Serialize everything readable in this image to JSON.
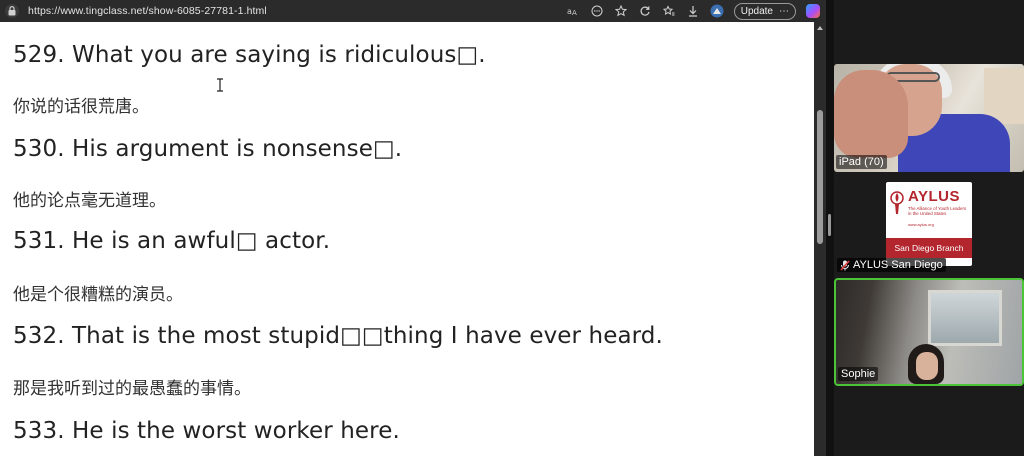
{
  "browser": {
    "url": "https://www.tingclass.net/show-6085-27781-1.html",
    "update_label": "Update",
    "more_label": "⋯"
  },
  "content": {
    "lines": [
      {
        "en": "529. What you are saying is ridiculous□.",
        "zh": "你说的话很荒唐。"
      },
      {
        "en": "530. His argument is nonsense□.",
        "zh": "他的论点毫无道理。"
      },
      {
        "en": "531. He is an awful□ actor.",
        "zh": "他是个很糟糕的演员。"
      },
      {
        "en": "532. That is the most stupid□□thing I have ever heard.",
        "zh": "那是我听到过的最愚蠢的事情。"
      },
      {
        "en": "533. He is the worst worker here."
      }
    ]
  },
  "video_panel": {
    "participants": [
      {
        "label": "iPad (70)"
      },
      {
        "label": "AYLUS San Diego",
        "muted": true,
        "card": {
          "title": "AYLUS",
          "subtitle": "The Alliance of Youth Leaders in the United States",
          "website": "www.aylus.org",
          "branch": "San Diego Branch"
        }
      },
      {
        "label": "Sophie",
        "active_speaker": true
      }
    ]
  },
  "colors": {
    "toolbar_bg": "#2b2b2b",
    "page_bg": "#ffffff",
    "aylus_red": "#b3262d",
    "active_speaker_border": "#4cc437"
  }
}
